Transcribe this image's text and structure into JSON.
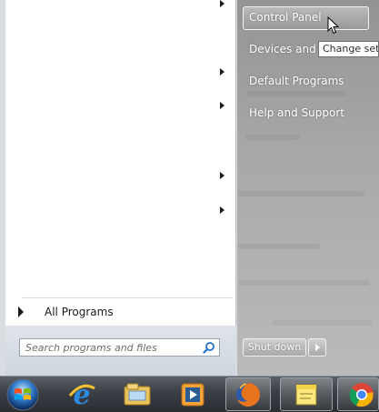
{
  "start_menu": {
    "all_programs_label": "All Programs",
    "search": {
      "placeholder": "Search programs and files"
    },
    "right_items": [
      {
        "label": "Control Panel"
      },
      {
        "label": "Devices and P"
      },
      {
        "label": "Default Programs"
      },
      {
        "label": "Help and Support"
      }
    ],
    "tooltip_text": "Change sett",
    "shutdown_label": "Shut down"
  },
  "taskbar": {
    "icons": [
      {
        "name": "start-orb-icon"
      },
      {
        "name": "internet-explorer-icon"
      },
      {
        "name": "file-explorer-icon"
      },
      {
        "name": "media-player-icon"
      },
      {
        "name": "firefox-icon"
      },
      {
        "name": "sticky-notes-icon"
      },
      {
        "name": "chrome-icon"
      }
    ]
  },
  "colors": {
    "taskbar": "#3b3f45",
    "menu_left": "#ffffff",
    "menu_right": "#7a7a7a",
    "accent_blue": "#1f6fcf"
  }
}
